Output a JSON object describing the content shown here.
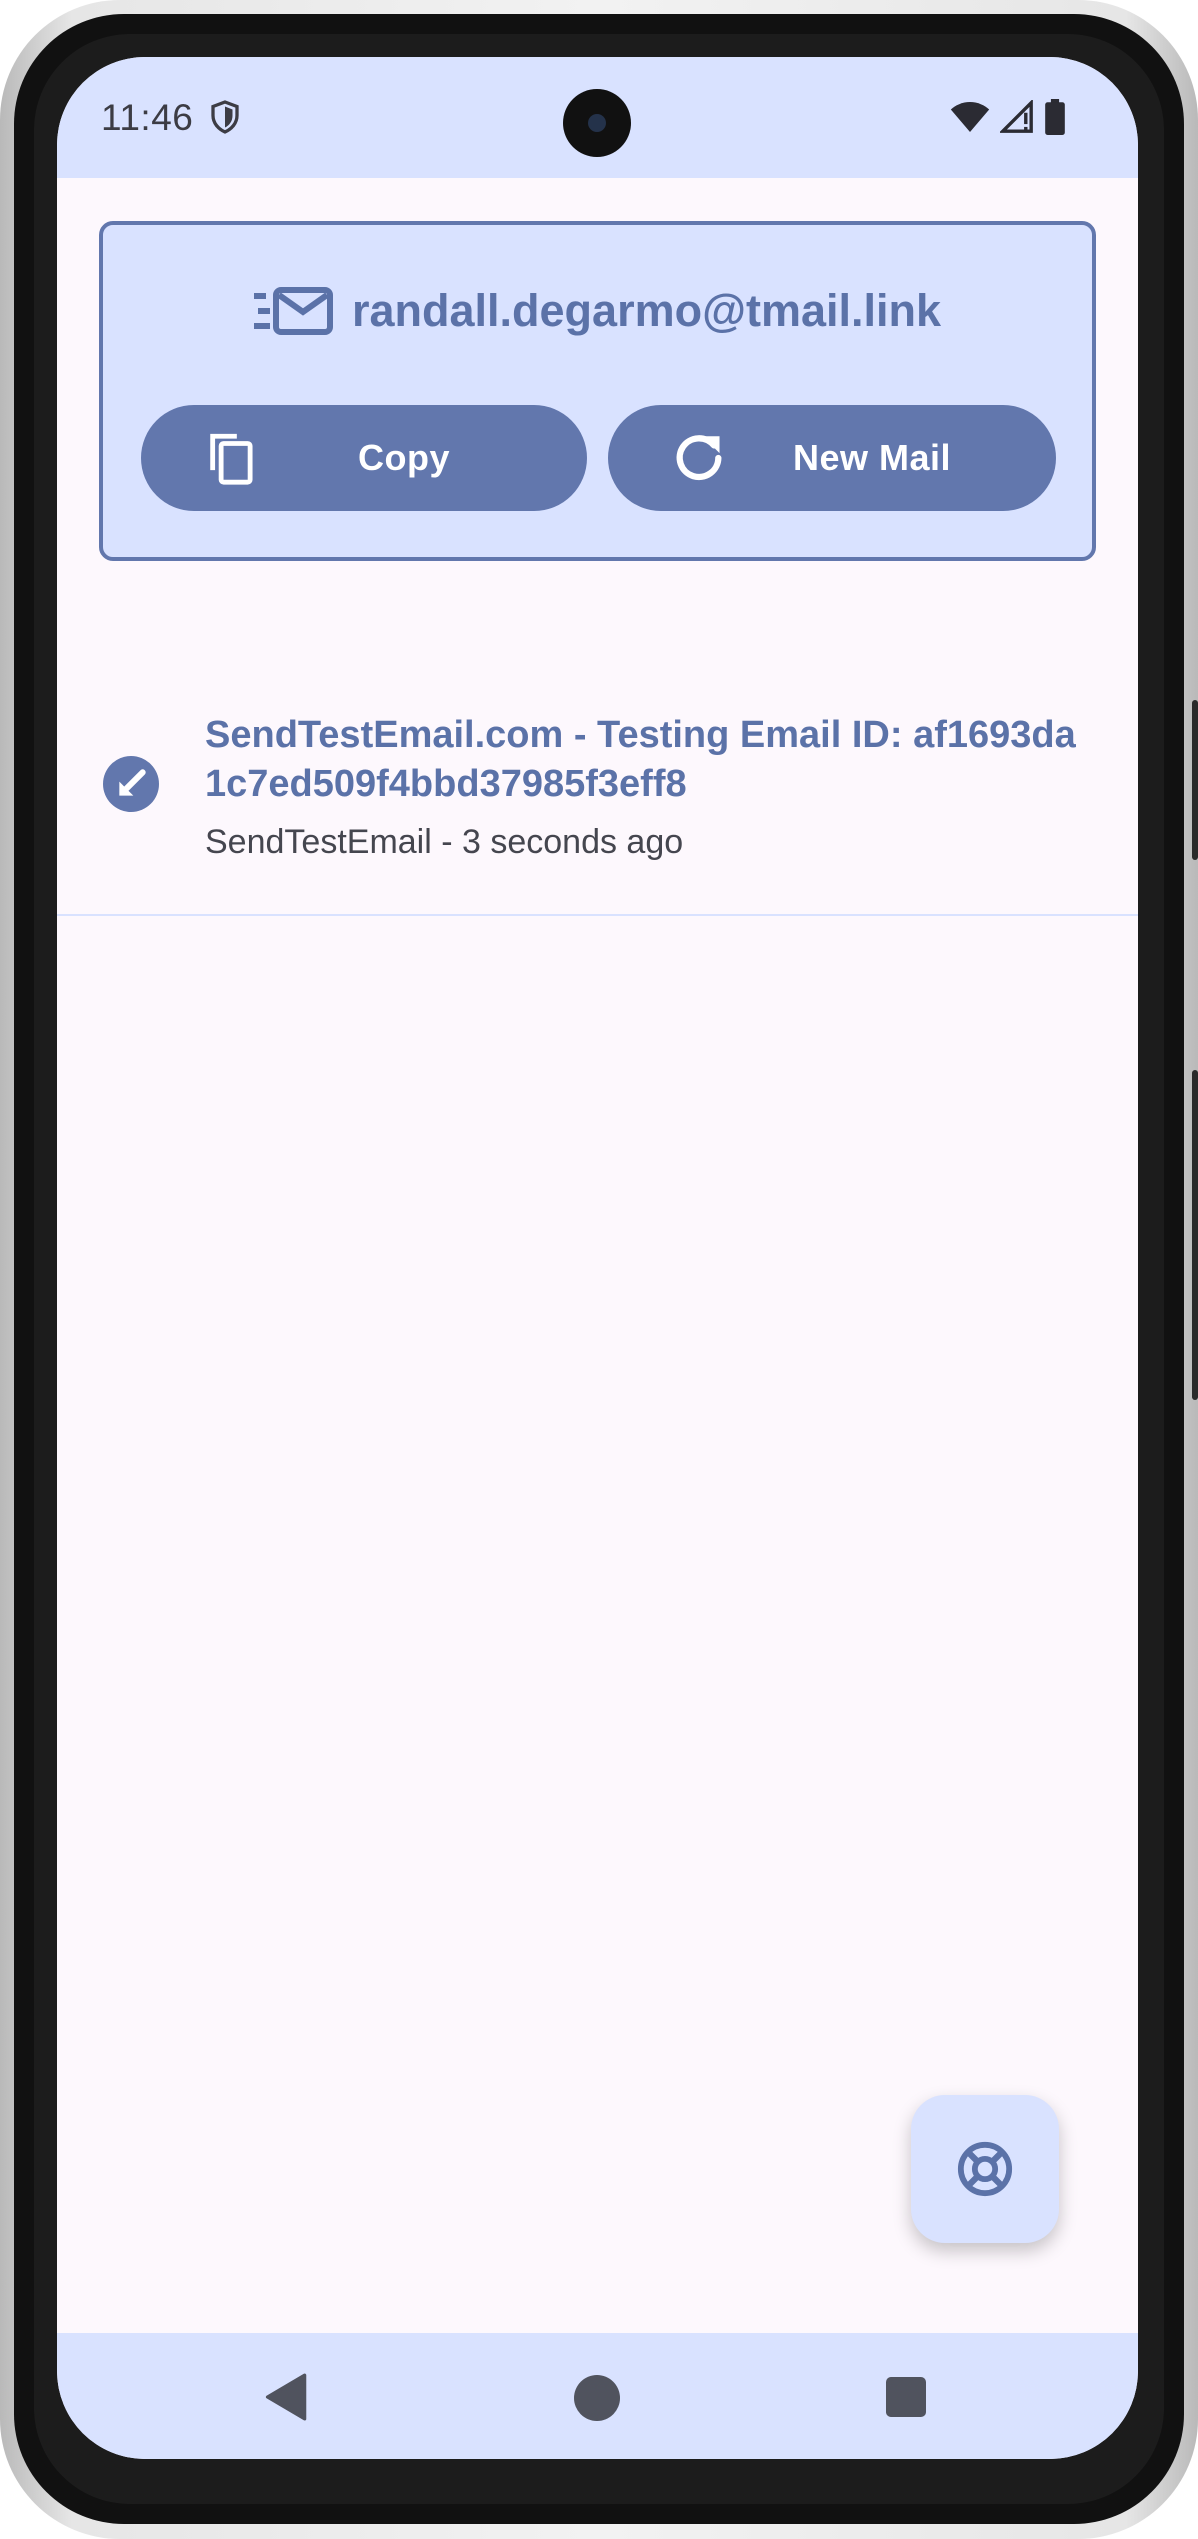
{
  "status_bar": {
    "time": "11:46",
    "icons": [
      "shield-icon",
      "wifi-icon",
      "signal-icon",
      "battery-icon"
    ]
  },
  "address_card": {
    "icon": "mail-fast-icon",
    "email_address": "randall.degarmo@tmail.link",
    "copy_button": {
      "label": "Copy",
      "icon": "copy-icon"
    },
    "new_mail_button": {
      "label": "New Mail",
      "icon": "refresh-icon"
    }
  },
  "inbox": {
    "items": [
      {
        "subject": "SendTestEmail.com - Testing Email ID: af1693da1c7ed509f4bbd37985f3eff8",
        "meta": "SendTestEmail - 3 seconds ago",
        "status_icon": "received-arrow-icon"
      }
    ]
  },
  "fab": {
    "icon": "lifebuoy-icon"
  },
  "nav_bar": {
    "items": [
      "back-icon",
      "home-icon",
      "recents-icon"
    ]
  },
  "colors": {
    "accent": "#6277ad",
    "accent_text": "#5b72a8",
    "surface_tint": "#d9e2ff",
    "background": "#fdf8fd",
    "secondary_text": "#45464f"
  }
}
